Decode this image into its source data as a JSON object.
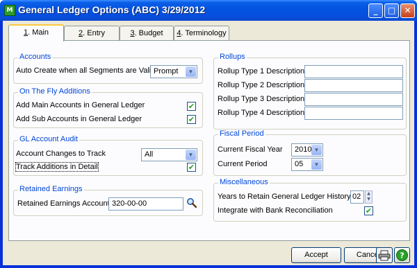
{
  "window": {
    "title": "General Ledger Options (ABC) 3/29/2012",
    "app_icon_text": "M"
  },
  "title_buttons": {
    "minimize": "_",
    "maximize": "□",
    "close": "✕"
  },
  "tabs": [
    {
      "key": "1",
      "label": ". Main"
    },
    {
      "key": "2",
      "label": ". Entry"
    },
    {
      "key": "3",
      "label": ". Budget"
    },
    {
      "key": "4",
      "label": ". Terminology"
    }
  ],
  "accounts": {
    "title": "Accounts",
    "auto_create_label": "Auto Create when all Segments are Valid",
    "auto_create_value": "Prompt"
  },
  "on_the_fly": {
    "title": "On The Fly Additions",
    "add_main_label": "Add Main Accounts in General Ledger",
    "add_main_checked": true,
    "add_sub_label": "Add Sub Accounts in General Ledger",
    "add_sub_checked": true
  },
  "audit": {
    "title": "GL Account Audit",
    "changes_label": "Account Changes to Track",
    "changes_value": "All",
    "track_additions_label": "Track Additions in Detail",
    "track_additions_checked": true
  },
  "retained": {
    "title": "Retained Earnings",
    "account_label": "Retained Earnings Account",
    "account_value": "320-00-00"
  },
  "rollups": {
    "title": "Rollups",
    "items": [
      {
        "label": "Rollup Type 1 Description",
        "value": ""
      },
      {
        "label": "Rollup Type 2 Description",
        "value": ""
      },
      {
        "label": "Rollup Type 3 Description",
        "value": ""
      },
      {
        "label": "Rollup Type 4 Description",
        "value": ""
      }
    ]
  },
  "fiscal": {
    "title": "Fiscal Period",
    "year_label": "Current Fiscal Year",
    "year_value": "2010",
    "period_label": "Current Period",
    "period_value": "05"
  },
  "misc": {
    "title": "Miscellaneous",
    "years_label": "Years to Retain General Ledger History",
    "years_value": "02",
    "bank_label": "Integrate with Bank Reconciliation",
    "bank_checked": true
  },
  "buttons": {
    "accept": "Accept",
    "cancel": "Cancel"
  },
  "icons": {
    "combo_arrow": "chevron-down-icon",
    "lookup": "magnifier-icon",
    "print": "printer-icon",
    "help": "help-icon"
  }
}
